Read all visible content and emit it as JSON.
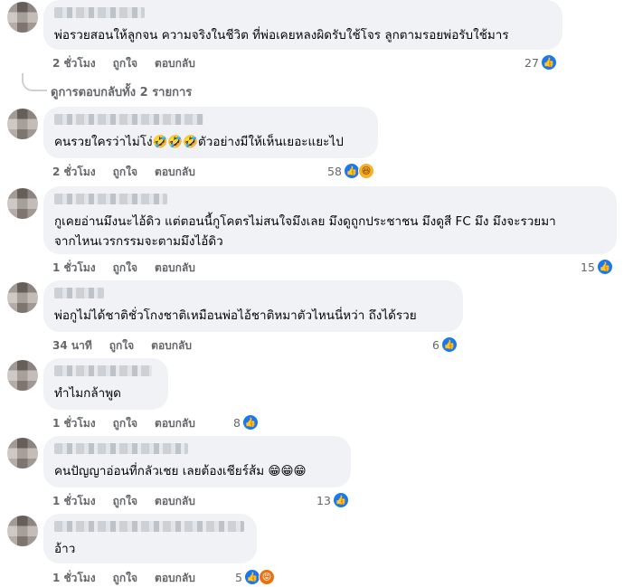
{
  "labels": {
    "like": "ถูกใจ",
    "reply": "ตอบกลับ"
  },
  "comments": [
    {
      "text": "พ่อรวยสอนให้ลูกจน ความจริงในชีวิต ที่พ่อเคยหลงผิดรับใช้โจร ลูกตามรอยพ่อรับใช้มาร",
      "time": "2 ชั่วโมง",
      "reaction_count": "27",
      "reactions": [
        "like-icon"
      ]
    },
    {
      "text": "คนรวยใครว่าไม่โง่🤣🤣🤣ตัวอย่างมีให้เห็นเยอะแยะไป",
      "time": "2 ชั่วโมง",
      "reaction_count": "58",
      "reactions": [
        "like-icon",
        "haha-icon"
      ]
    },
    {
      "text": "กูเคยอ่านมึงนะไอ้ดิว แต่ตอนนี้กูโคตรไม่สนใจมึงเลย มึงดูถูกประชาชน มึงดูสี FC มึง มึงจะรวยมา\nจากไหนเวรกรรมจะตามมึงไอ้ดิว",
      "time": "1 ชั่วโมง",
      "reaction_count": "15",
      "reactions": [
        "like-icon"
      ]
    },
    {
      "text": "พ่อกูไม่ได้ชาติชั่วโกงชาติเหมือนพ่อไอ้ชาติหมาตัวไหนนี่หว่า ถึงได้รวย",
      "time": "34 นาที",
      "reaction_count": "6",
      "reactions": [
        "like-icon"
      ]
    },
    {
      "text": "ทำไมกล้าพูด",
      "time": "1 ชั่วโมง",
      "reaction_count": "8",
      "reactions": [
        "like-icon"
      ]
    },
    {
      "text": "คนปัญญาอ่อนที่กลัวเชย เลยต้องเชียร์ส้ม 😁😁😁",
      "time": "1 ชั่วโมง",
      "reaction_count": "13",
      "reactions": [
        "like-icon"
      ]
    },
    {
      "text": "อ้าว",
      "time": "1 ชั่วโมง",
      "reaction_count": "5",
      "reactions": [
        "like-icon",
        "angry-icon"
      ]
    }
  ],
  "view_replies": "ดูการตอบกลับทั้ง 2 รายการ"
}
